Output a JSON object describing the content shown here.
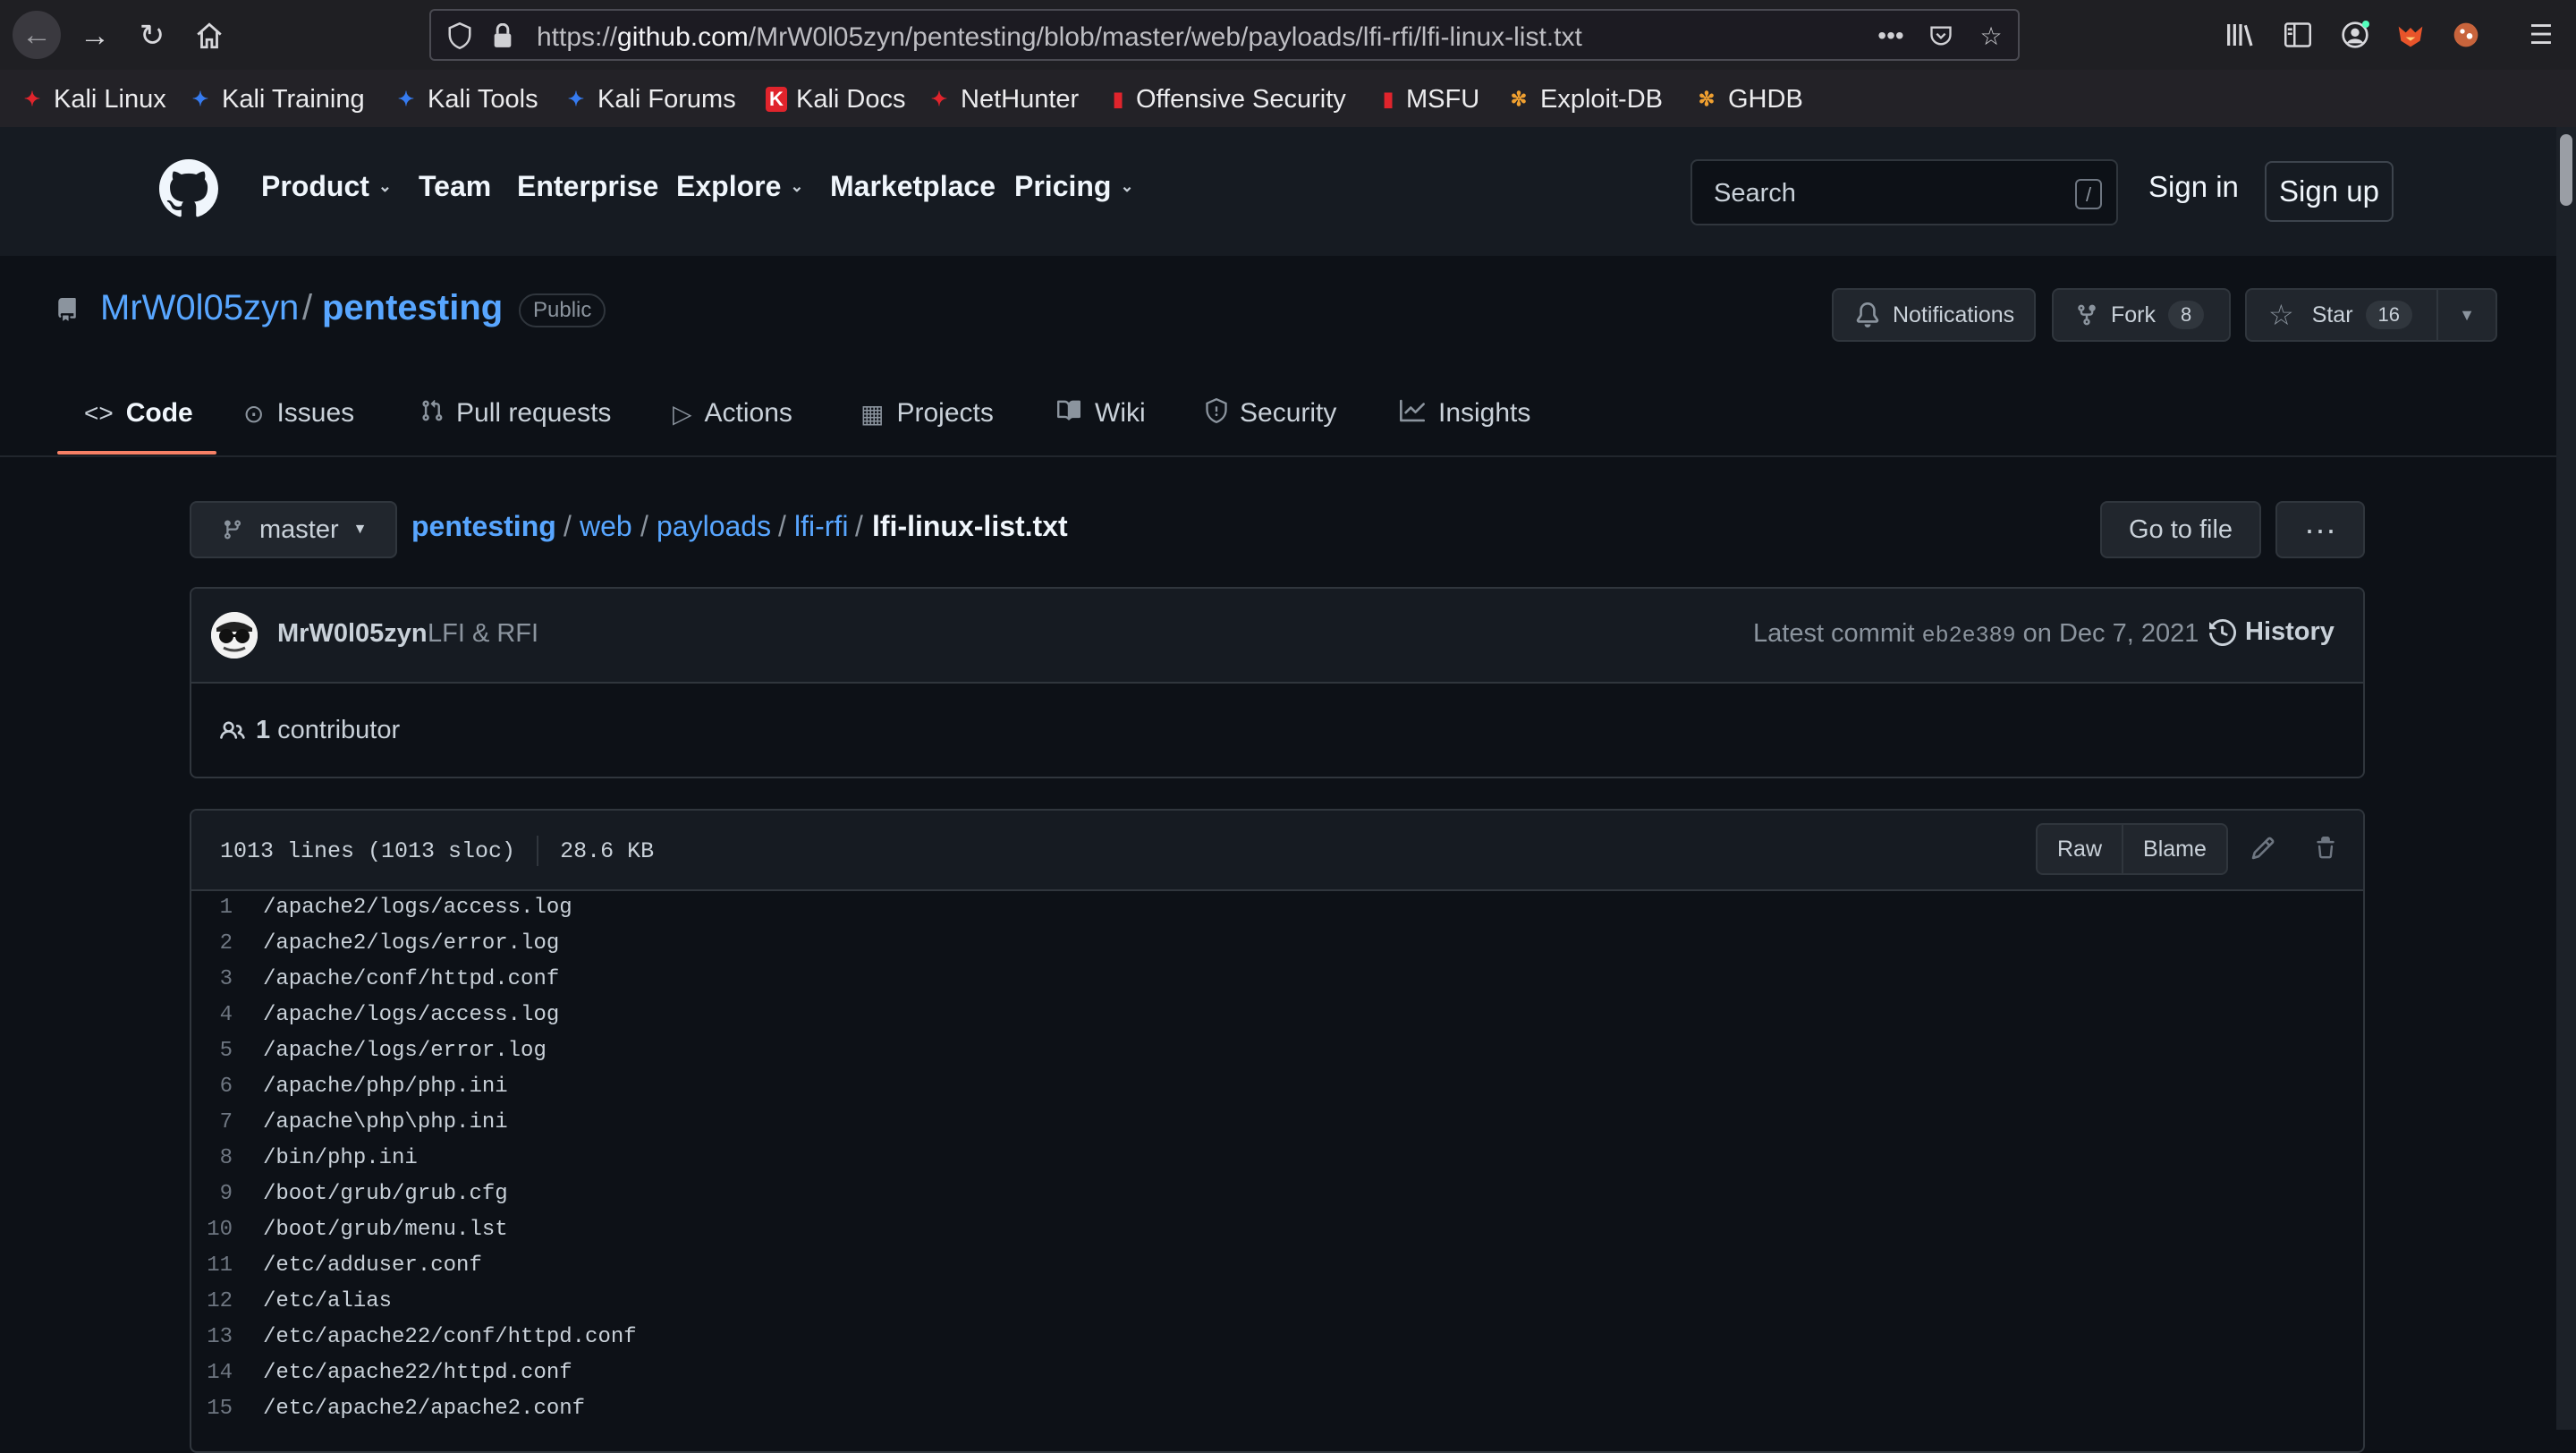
{
  "browser": {
    "url_prefix": "https://",
    "url_domain": "github.com",
    "url_path": "/MrW0l05zyn/pentesting/blob/master/web/payloads/lfi-rfi/lfi-linux-list.txt",
    "bookmarks": [
      {
        "label": "Kali Linux",
        "icon": "kali-icon",
        "color": "#367bf0"
      },
      {
        "label": "Kali Training",
        "icon": "kali-icon",
        "color": "#367bf0"
      },
      {
        "label": "Kali Tools",
        "icon": "kali-icon",
        "color": "#367bf0"
      },
      {
        "label": "Kali Forums",
        "icon": "kali-icon",
        "color": "#367bf0"
      },
      {
        "label": "Kali Docs",
        "icon": "kali-docs-icon",
        "color": "#e0242c"
      },
      {
        "label": "NetHunter",
        "icon": "kali-icon",
        "color": "#e0242c"
      },
      {
        "label": "Offensive Security",
        "icon": "offsec-icon",
        "color": "#e0242c"
      },
      {
        "label": "MSFU",
        "icon": "offsec-icon",
        "color": "#e0242c"
      },
      {
        "label": "Exploit-DB",
        "icon": "exploitdb-icon",
        "color": "#f0a030"
      },
      {
        "label": "GHDB",
        "icon": "exploitdb-icon",
        "color": "#f0a030"
      }
    ]
  },
  "header": {
    "nav": [
      "Product",
      "Team",
      "Enterprise",
      "Explore",
      "Marketplace",
      "Pricing"
    ],
    "search_placeholder": "Search",
    "search_shortcut": "/",
    "sign_in": "Sign in",
    "sign_up": "Sign up"
  },
  "repo": {
    "owner": "MrW0l05zyn",
    "separator": "/",
    "name": "pentesting",
    "visibility": "Public",
    "notifications": "Notifications",
    "fork_label": "Fork",
    "fork_count": "8",
    "star_label": "Star",
    "star_count": "16"
  },
  "tabs": [
    "Code",
    "Issues",
    "Pull requests",
    "Actions",
    "Projects",
    "Wiki",
    "Security",
    "Insights"
  ],
  "file": {
    "branch": "master",
    "breadcrumb": [
      "pentesting",
      "web",
      "payloads",
      "lfi-rfi"
    ],
    "filename": "lfi-linux-list.txt",
    "go_to_file": "Go to file",
    "more": "···",
    "commit_author": "MrW0l05zyn",
    "commit_message": "LFI & RFI",
    "latest_commit_label": "Latest commit",
    "commit_sha": "eb2e389",
    "commit_date": "on Dec 7, 2021",
    "history": "History",
    "contributors_count": "1",
    "contributors_label": "contributor",
    "lines_info": "1013 lines (1013 sloc)",
    "size": "28.6 KB",
    "raw": "Raw",
    "blame": "Blame"
  },
  "code_lines": [
    "/apache2/logs/access.log",
    "/apache2/logs/error.log",
    "/apache/conf/httpd.conf",
    "/apache/logs/access.log",
    "/apache/logs/error.log",
    "/apache/php/php.ini",
    "/apache\\php\\php.ini",
    "/bin/php.ini",
    "/boot/grub/grub.cfg",
    "/boot/grub/menu.lst",
    "/etc/adduser.conf",
    "/etc/alias",
    "/etc/apache22/conf/httpd.conf",
    "/etc/apache22/httpd.conf",
    "/etc/apache2/apache2.conf"
  ]
}
